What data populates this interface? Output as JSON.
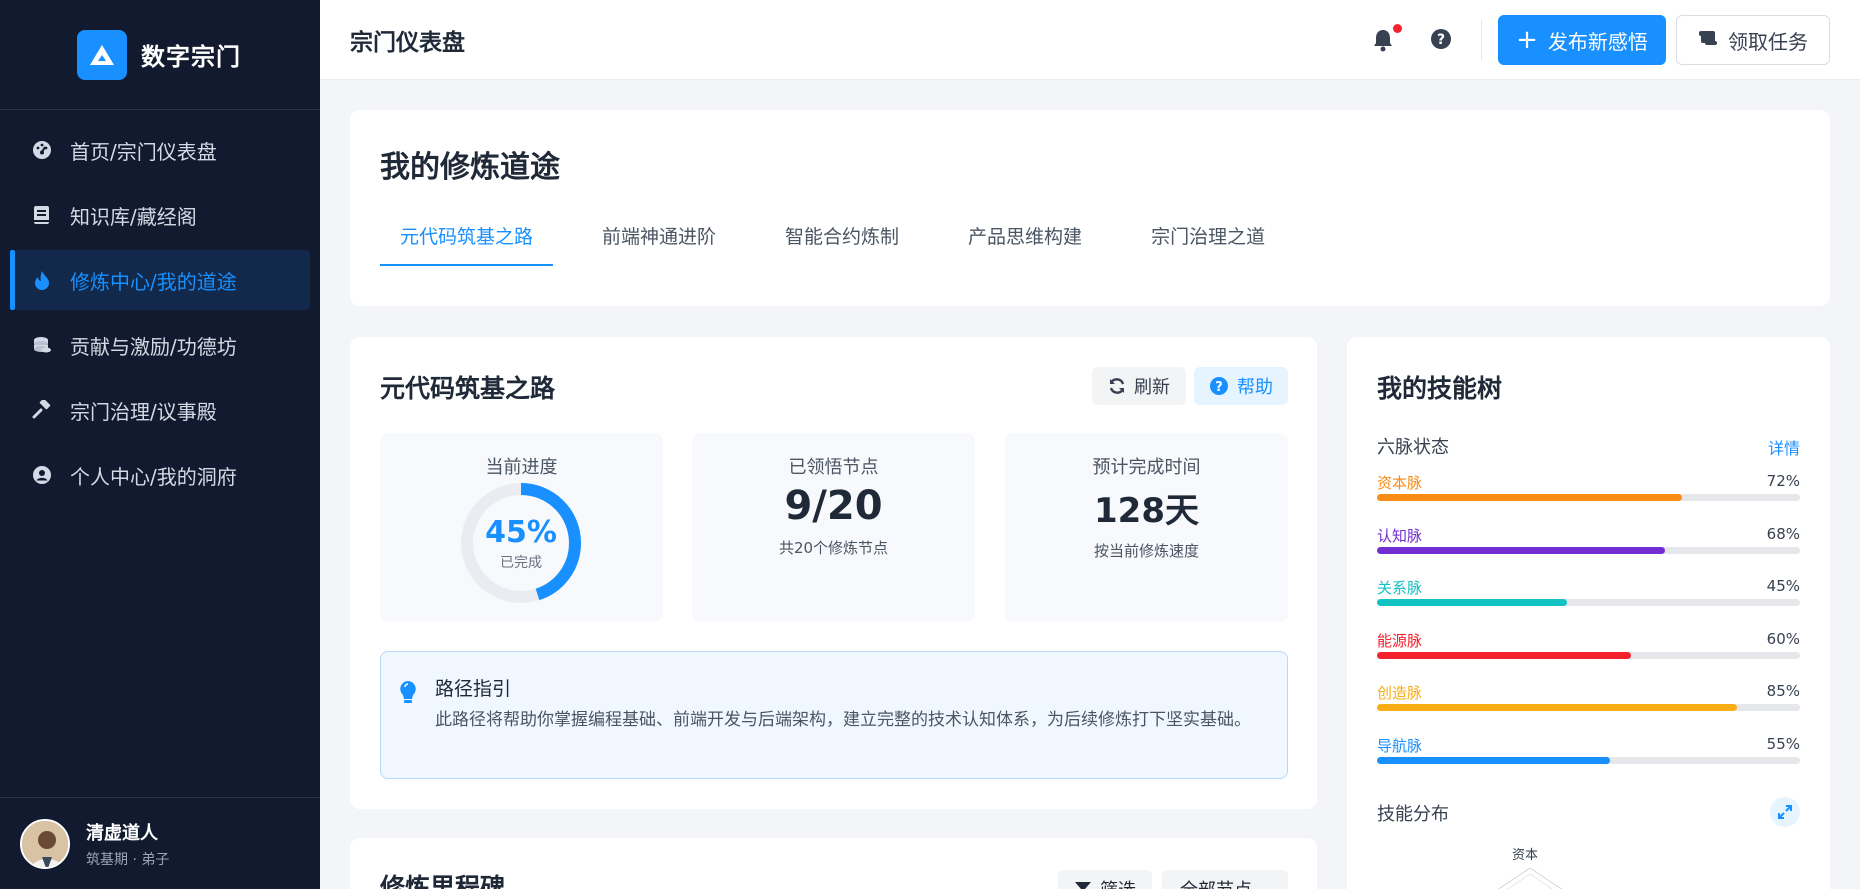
{
  "app": {
    "brand": "数字宗门",
    "page_title": "宗门仪表盘"
  },
  "sidebar": {
    "items": [
      {
        "label": "首页/宗门仪表盘",
        "icon": "dashboard-icon",
        "active": false
      },
      {
        "label": "知识库/藏经阁",
        "icon": "book-icon",
        "active": false
      },
      {
        "label": "修炼中心/我的道途",
        "icon": "flame-icon",
        "active": true
      },
      {
        "label": "贡献与激励/功德坊",
        "icon": "coins-icon",
        "active": false
      },
      {
        "label": "宗门治理/议事殿",
        "icon": "gavel-icon",
        "active": false
      },
      {
        "label": "个人中心/我的洞府",
        "icon": "user-circle-icon",
        "active": false
      }
    ],
    "user": {
      "name": "清虚道人",
      "role": "筑基期 · 弟子"
    }
  },
  "topbar": {
    "primary_button": "发布新感悟",
    "secondary_button": "领取任务",
    "has_notification": true
  },
  "path_card": {
    "title": "我的修炼道途",
    "tabs": [
      "元代码筑基之路",
      "前端神通进阶",
      "智能合约炼制",
      "产品思维构建",
      "宗门治理之道"
    ],
    "active_tab": 0
  },
  "road_card": {
    "title": "元代码筑基之路",
    "refresh_label": "刷新",
    "help_label": "帮助",
    "progress": {
      "label": "当前进度",
      "value": "45%",
      "fraction": 0.45,
      "sub": "已完成"
    },
    "nodes": {
      "label": "已领悟节点",
      "value": "9/20",
      "sub": "共20个修炼节点"
    },
    "eta": {
      "label": "预计完成时间",
      "value": "128天",
      "sub": "按当前修炼速度"
    },
    "guide": {
      "title": "路径指引",
      "text": "此路径将帮助你掌握编程基础、前端开发与后端架构，建立完整的技术认知体系，为后续修炼打下坚实基础。"
    }
  },
  "milestone_card": {
    "title": "修炼里程碑",
    "filter_label": "筛选",
    "select_value": "全部节点"
  },
  "skill_card": {
    "title": "我的技能树",
    "section_status": "六脉状态",
    "detail_link": "详情",
    "skills": [
      {
        "name": "资本脉",
        "pct": "72%",
        "value": 0.72,
        "color": "#fa8c16"
      },
      {
        "name": "认知脉",
        "pct": "68%",
        "value": 0.68,
        "color": "#722ed1"
      },
      {
        "name": "关系脉",
        "pct": "45%",
        "value": 0.45,
        "color": "#13c2c2"
      },
      {
        "name": "能源脉",
        "pct": "60%",
        "value": 0.6,
        "color": "#f5222d"
      },
      {
        "name": "创造脉",
        "pct": "85%",
        "value": 0.85,
        "color": "#faad14"
      },
      {
        "name": "导航脉",
        "pct": "55%",
        "value": 0.55,
        "color": "#1890ff"
      }
    ],
    "section_dist": "技能分布",
    "radar_top_label": "资本"
  },
  "colors": {
    "primary": "#1890ff",
    "sidebar_bg": "#111a2e"
  }
}
